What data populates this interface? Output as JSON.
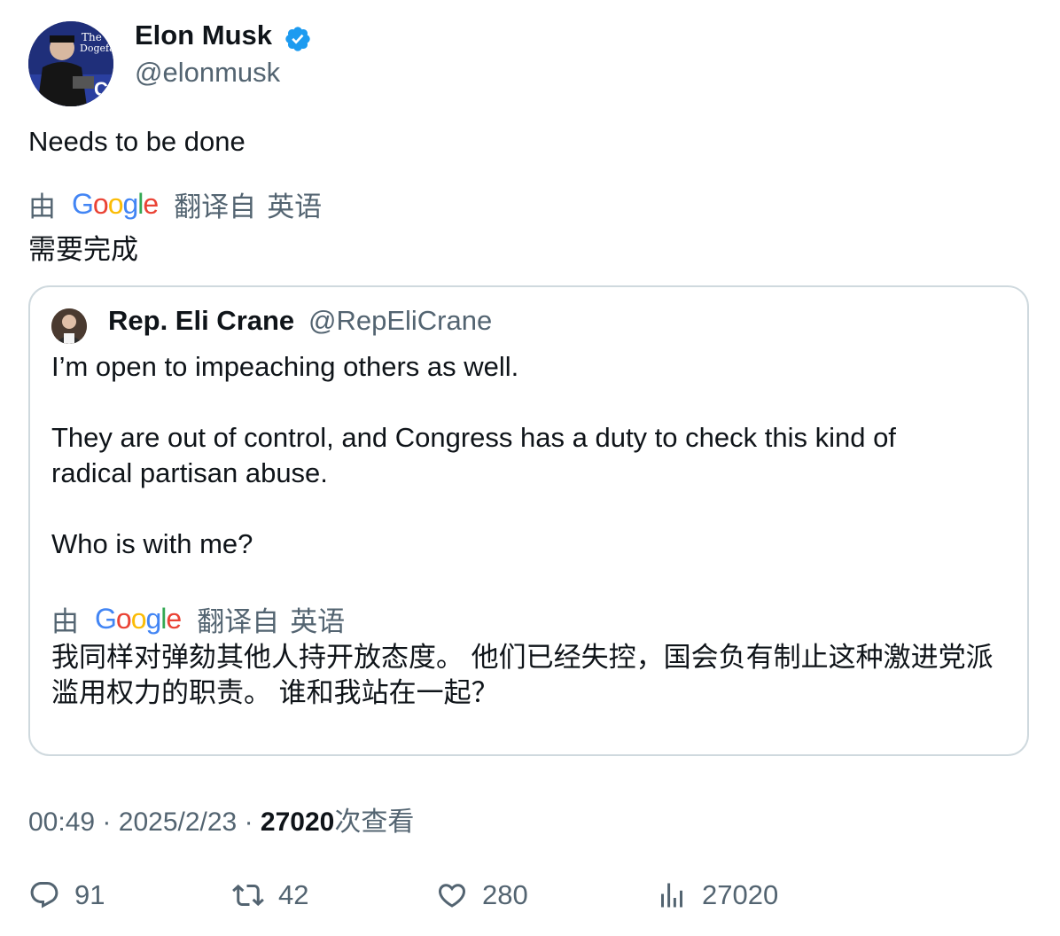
{
  "author": {
    "name": "Elon Musk",
    "handle": "@elonmusk",
    "avatar_icon": "avatar-photo",
    "verified_icon": "verified-badge-icon",
    "verified_color": "#1d9bf0"
  },
  "tweet": {
    "text": "Needs to be done",
    "translation": {
      "by": "由",
      "provider": "Google",
      "translated_from": "翻译自",
      "language": "英语",
      "text": "需要完成"
    }
  },
  "quote": {
    "name": "Rep. Eli Crane",
    "handle": "@RepEliCrane",
    "lines": [
      "I’m open to impeaching others as well.",
      "They are out of control, and Congress has a duty to check this kind of",
      "radical partisan abuse.",
      "Who is with me?"
    ],
    "translation": {
      "by": "由",
      "provider": "Google",
      "translated_from": "翻译自",
      "language": "英语",
      "text": "我同样对弹劾其他人持开放态度。 他们已经失控，国会负有制止这种激进党派滥用权力的职责。 谁和我站在一起？"
    }
  },
  "meta": {
    "time": "00:49",
    "date": "2025/2/23",
    "views": "27020",
    "views_suffix": "次查看",
    "separator": "·"
  },
  "actions": {
    "replies": "91",
    "retweets": "42",
    "likes": "280",
    "views": "27020"
  },
  "colors": {
    "text": "#0f1419",
    "secondary": "#536471",
    "border": "#cfd9de"
  }
}
